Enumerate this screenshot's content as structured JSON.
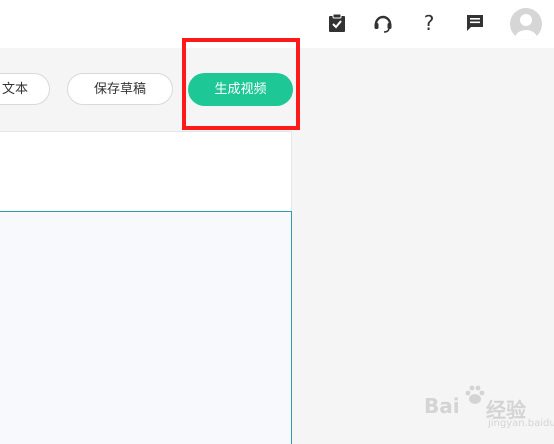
{
  "header": {
    "icons": {
      "tasks": "clipboard-check-icon",
      "support": "headset-icon",
      "help": "question-icon",
      "help_glyph": "?",
      "messages": "message-icon",
      "avatar": "user-avatar"
    }
  },
  "toolbar": {
    "text_button_label": "文本",
    "save_draft_label": "保存草稿",
    "generate_video_label": "生成视频"
  },
  "watermark": {
    "brand": "Bai",
    "product": "经验",
    "url": "jingyan.baidu.com"
  },
  "colors": {
    "primary": "#1ec896",
    "highlight": "#ff1a1a",
    "editor_border": "#2a9fb0",
    "background": "#f5f5f5"
  }
}
